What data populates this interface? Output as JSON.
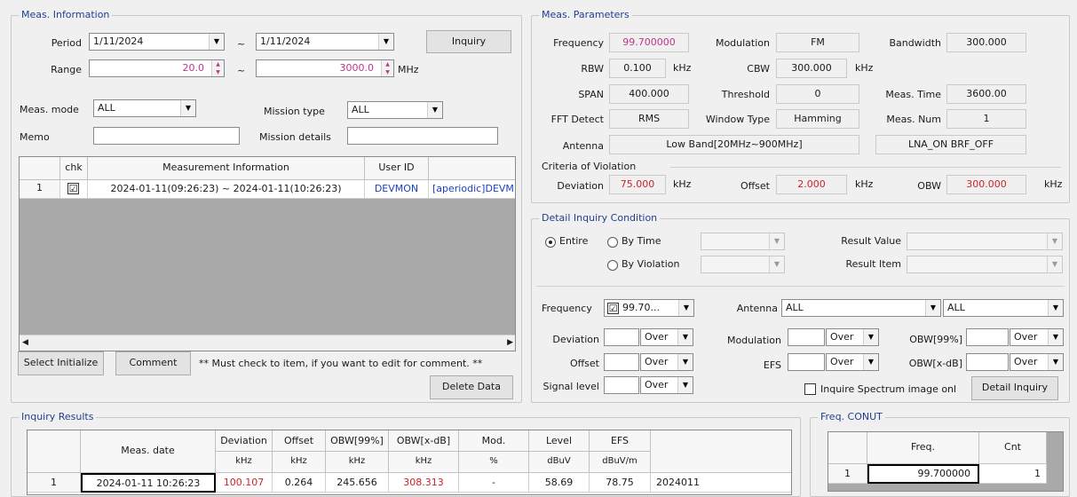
{
  "meas_info": {
    "title": "Meas. Information",
    "period_label": "Period",
    "period_from": "1/11/2024",
    "period_to": "1/11/2024",
    "tilde": "~",
    "inquiry_btn": "Inquiry",
    "range_label": "Range",
    "range_from": "20.0",
    "range_to": "3000.0",
    "range_unit": "MHz",
    "meas_mode_label": "Meas. mode",
    "meas_mode_value": "ALL",
    "mission_type_label": "Mission type",
    "mission_type_value": "ALL",
    "memo_label": "Memo",
    "memo_value": "",
    "mission_details_label": "Mission details",
    "mission_details_value": "",
    "grid_headers": [
      "chk",
      "Measurement Information",
      "User ID"
    ],
    "rows": [
      {
        "num": "1",
        "checked": "☑",
        "info": "2024-01-11(09:26:23) ~ 2024-01-11(10:26:23)",
        "user": "DEVMON",
        "extra": "[aperiodic]DEVM"
      }
    ],
    "select_init_btn": "Select Initialize",
    "comment_btn": "Comment",
    "note": "** Must check to item, if you want to edit for comment. **",
    "delete_btn": "Delete Data"
  },
  "meas_params": {
    "title": "Meas. Parameters",
    "frequency_label": "Frequency",
    "frequency_value": "99.700000",
    "modulation_label": "Modulation",
    "modulation_value": "FM",
    "bandwidth_label": "Bandwidth",
    "bandwidth_value": "300.000",
    "rbw_label": "RBW",
    "rbw_value": "0.100",
    "khz": "kHz",
    "cbw_label": "CBW",
    "cbw_value": "300.000",
    "span_label": "SPAN",
    "span_value": "400.000",
    "threshold_label": "Threshold",
    "threshold_value": "0",
    "meas_time_label": "Meas. Time",
    "meas_time_value": "3600.00",
    "fft_label": "FFT Detect",
    "fft_value": "RMS",
    "window_label": "Window Type",
    "window_value": "Hamming",
    "meas_num_label": "Meas. Num",
    "meas_num_value": "1",
    "antenna_label": "Antenna",
    "antenna_value": "Low Band[20MHz~900MHz]",
    "lna_value": "LNA_ON BRF_OFF",
    "criteria_label": "Criteria of Violation",
    "deviation_label": "Deviation",
    "deviation_value": "75.000",
    "offset_label": "Offset",
    "offset_value": "2.000",
    "obw_label": "OBW",
    "obw_value": "300.000"
  },
  "detail": {
    "title": "Detail Inquiry Condition",
    "entire_label": "Entire",
    "by_time_label": "By Time",
    "by_violation_label": "By Violation",
    "result_value_label": "Result Value",
    "result_item_label": "Result Item",
    "frequency_label": "Frequency",
    "frequency_value": "99.70...",
    "antenna_label": "Antenna",
    "antenna_value": "ALL",
    "antenna_value2": "ALL",
    "deviation_label": "Deviation",
    "modulation_label": "Modulation",
    "obw99_label": "OBW[99%]",
    "offset_label": "Offset",
    "efs_label": "EFS",
    "obwx_label": "OBW[x-dB]",
    "signal_label": "Signal level",
    "over": "Over",
    "inquire_spectrum_label": "Inquire Spectrum image onl",
    "detail_inquiry_btn": "Detail Inquiry"
  },
  "results": {
    "title": "Inquiry Results",
    "headers": [
      "Meas. date",
      "Deviation",
      "Offset",
      "OBW[99%]",
      "OBW[x-dB]",
      "Mod.",
      "Level",
      "EFS"
    ],
    "units": [
      "kHz",
      "kHz",
      "kHz",
      "kHz",
      "%",
      "dBuV",
      "dBuV/m"
    ],
    "rows": [
      {
        "num": "1",
        "date": "2024-01-11 10:26:23",
        "deviation": "100.107",
        "offset": "0.264",
        "obw99": "245.656",
        "obwx": "308.313",
        "mod": "-",
        "level": "58.69",
        "efs": "78.75",
        "extra": "2024011"
      }
    ]
  },
  "freq_count": {
    "title": "Freq. CONUT",
    "headers": [
      "Freq.",
      "Cnt"
    ],
    "rows": [
      {
        "num": "1",
        "freq": "99.700000",
        "cnt": "1"
      }
    ]
  },
  "colors": {
    "pink": "#c0348a",
    "red": "#d0202a",
    "blue": "#1c3fbf",
    "title": "#1f3f8f"
  }
}
